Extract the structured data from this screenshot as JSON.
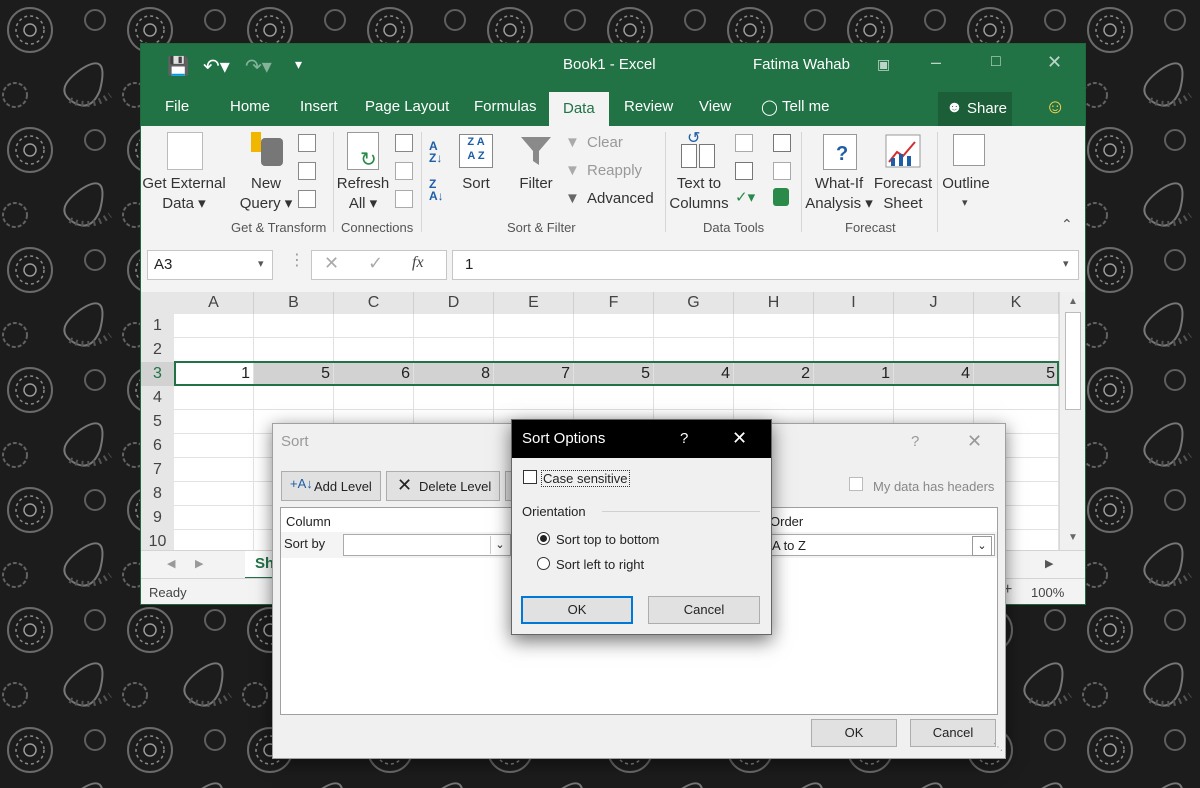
{
  "window": {
    "title": "Book1  -  Excel",
    "user": "Fatima Wahab",
    "accent": "#217346"
  },
  "tabs": [
    "File",
    "Home",
    "Insert",
    "Page Layout",
    "Formulas",
    "Data",
    "Review",
    "View",
    "Tell me"
  ],
  "active_tab": "Data",
  "share_label": "Share",
  "ribbon": {
    "get_external_data": [
      "Get External",
      "Data ▾"
    ],
    "new_query": [
      "New",
      "Query ▾"
    ],
    "refresh_all": [
      "Refresh",
      "All ▾"
    ],
    "sort": "Sort",
    "filter": "Filter",
    "clear": "Clear",
    "reapply": "Reapply",
    "advanced": "Advanced",
    "text_to_columns": [
      "Text to",
      "Columns"
    ],
    "what_if": [
      "What-If",
      "Analysis ▾"
    ],
    "forecast_sheet": [
      "Forecast",
      "Sheet"
    ],
    "outline": "Outline",
    "groups": [
      "Get & Transform",
      "Connections",
      "Sort & Filter",
      "Data Tools",
      "Forecast"
    ]
  },
  "formula_bar": {
    "name_box": "A3",
    "formula": "1",
    "fx": "fx"
  },
  "grid": {
    "columns": [
      "A",
      "B",
      "C",
      "D",
      "E",
      "F",
      "G",
      "H",
      "I",
      "J",
      "K"
    ],
    "rows": [
      "1",
      "2",
      "3",
      "4",
      "5",
      "6",
      "7",
      "8",
      "9",
      "10"
    ],
    "row3_values": [
      "1",
      "5",
      "6",
      "8",
      "7",
      "5",
      "4",
      "2",
      "1",
      "4",
      "5"
    ]
  },
  "sheet_tab": "Sh",
  "status": {
    "ready": "Ready",
    "zoom": "100%"
  },
  "sort_dialog": {
    "title": "Sort",
    "add_level": "Add Level",
    "delete_level": "Delete Level",
    "my_data_has_headers": "My data has headers",
    "column_header": "Column",
    "order_header": "Order",
    "sort_by": "Sort by",
    "order_value": "A to Z",
    "ok": "OK",
    "cancel": "Cancel"
  },
  "options_dialog": {
    "title": "Sort Options",
    "help": "?",
    "case_sensitive": "Case sensitive",
    "case_sensitive_checked": false,
    "orientation_label": "Orientation",
    "top_to_bottom": "Sort top to bottom",
    "left_to_right": "Sort left to right",
    "selected": "top_to_bottom",
    "ok": "OK",
    "cancel": "Cancel"
  }
}
